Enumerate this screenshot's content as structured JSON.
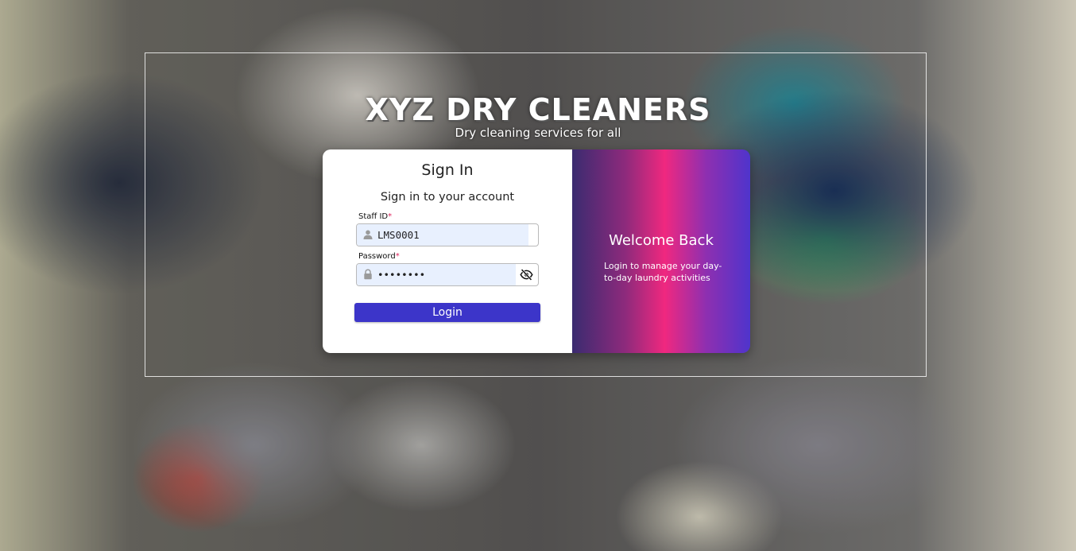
{
  "brand": {
    "title": "XYZ DRY CLEANERS",
    "tagline": "Dry cleaning services for all"
  },
  "signin": {
    "title": "Sign In",
    "subtitle": "Sign in to your account",
    "staff_id": {
      "label": "Staff ID",
      "required_mark": "*",
      "value": "LMS0001",
      "icon": "user-icon"
    },
    "password": {
      "label": "Password",
      "required_mark": "*",
      "value": "password",
      "icon": "lock-icon",
      "toggle_icon": "eye-slash-icon"
    },
    "login_label": "Login"
  },
  "welcome": {
    "title": "Welcome Back",
    "text": "Login to manage your day-to-day laundry activities"
  },
  "colors": {
    "button": "#3c35c9",
    "required": "#e0245e",
    "autofill": "#e8f0fe",
    "gradient_pink": "#f0287f",
    "gradient_violet": "#4f34cc"
  }
}
